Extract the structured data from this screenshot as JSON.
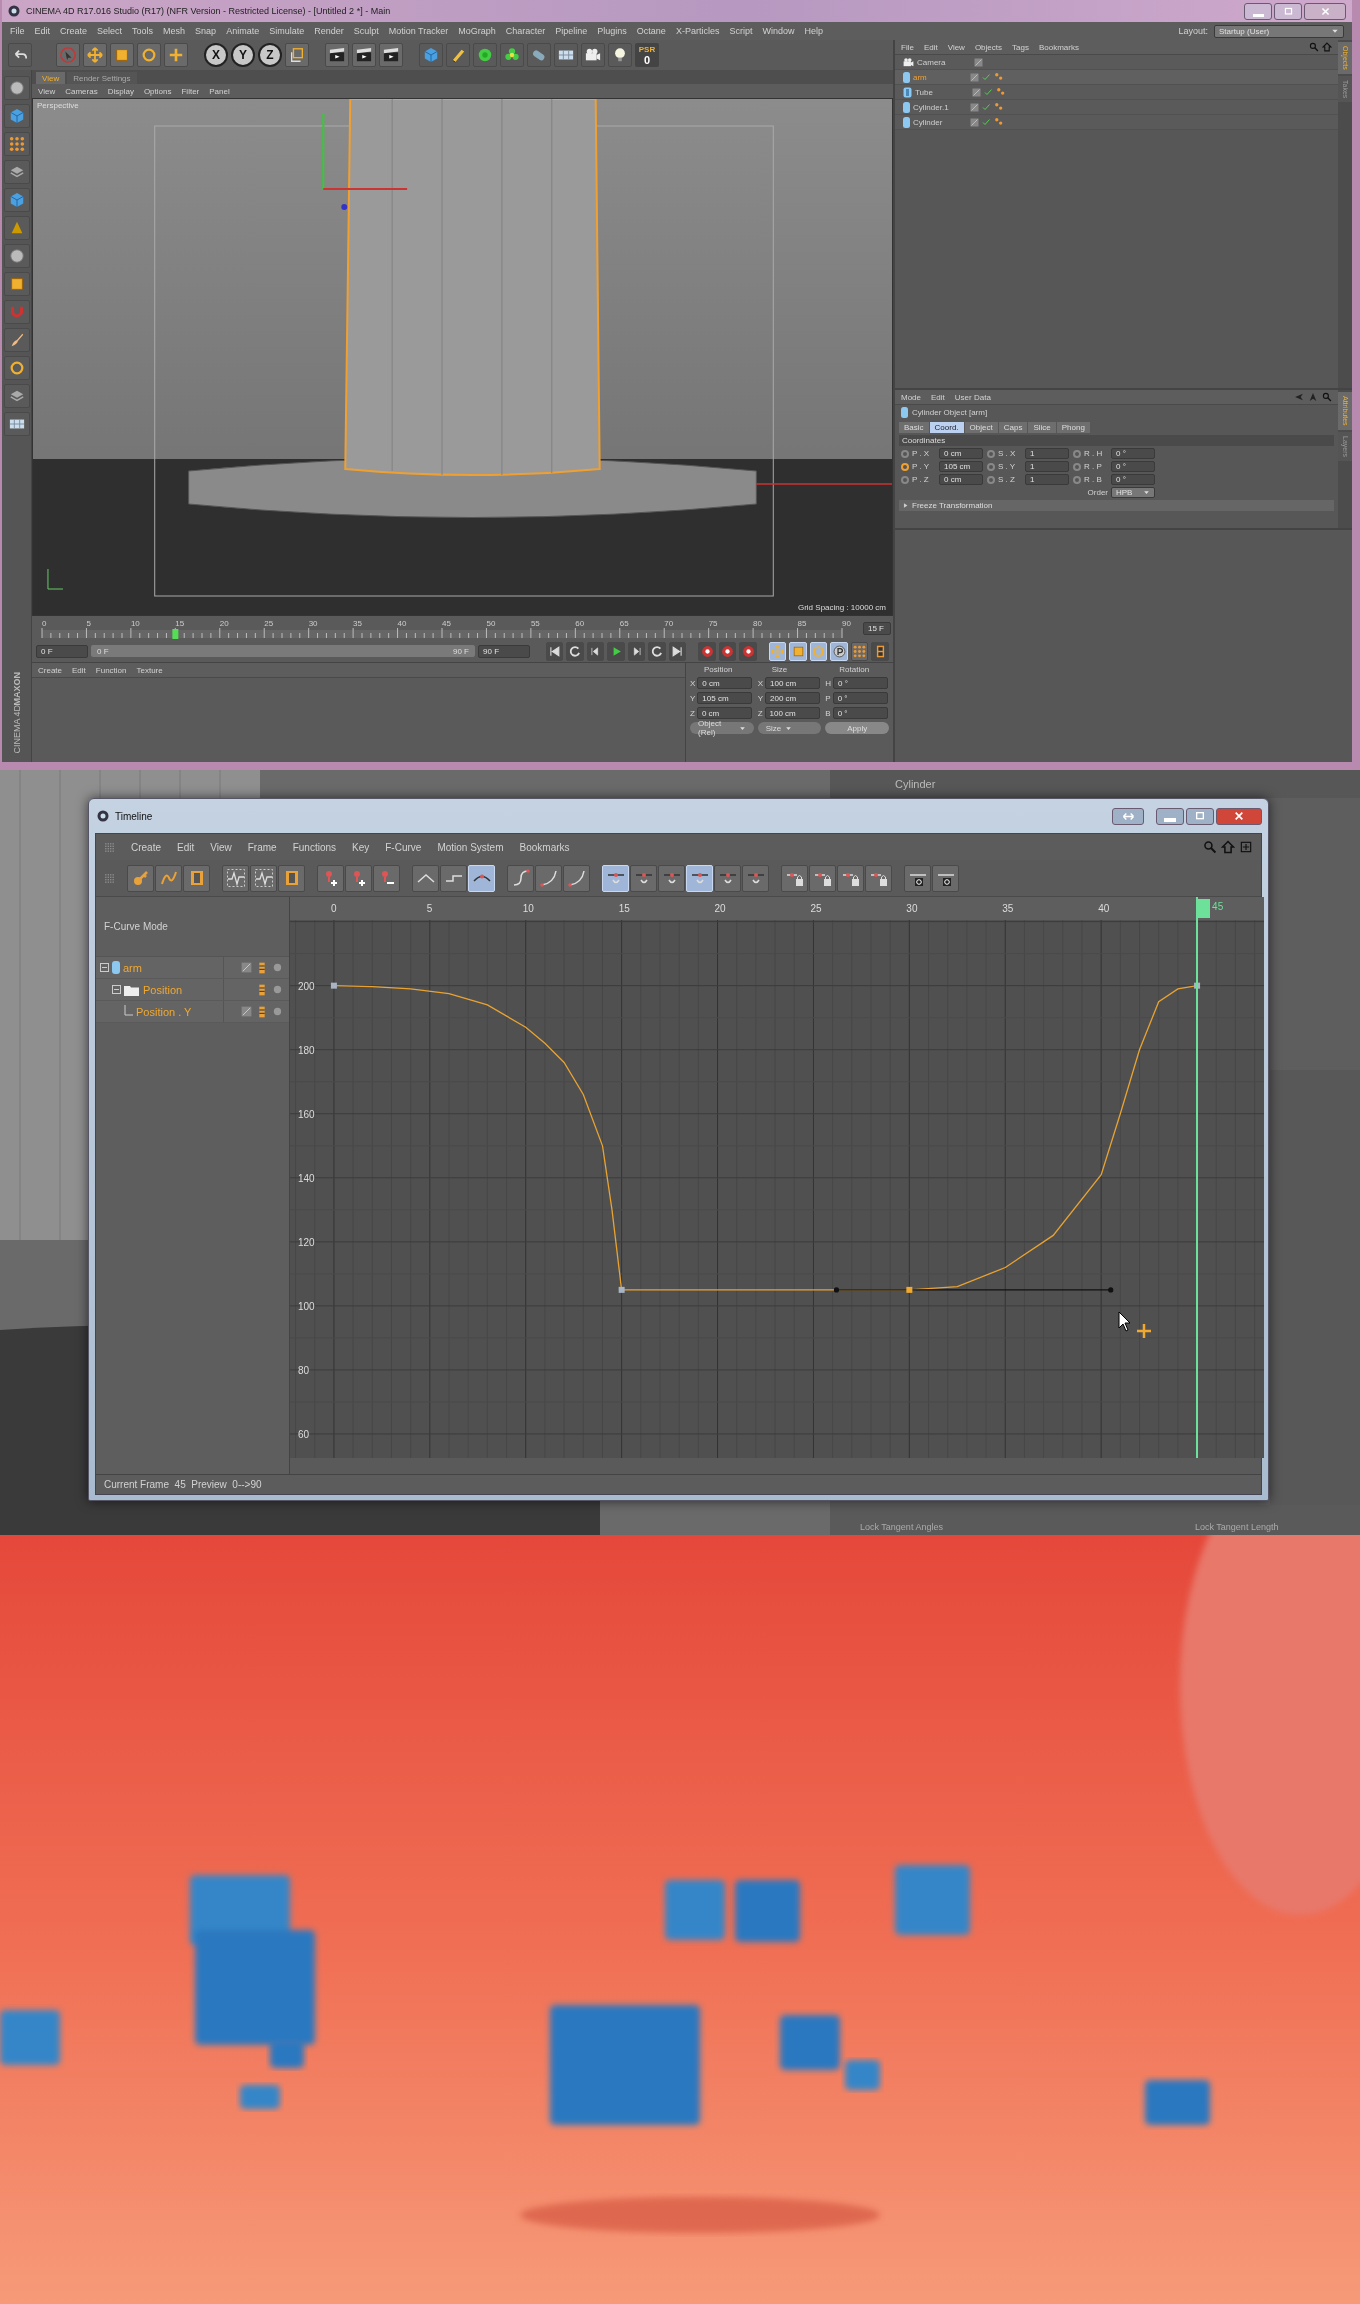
{
  "main_window": {
    "title": "CINEMA 4D R17.016 Studio (R17) (NFR Version - Restricted License) - [Untitled 2 *] - Main",
    "menu": [
      "File",
      "Edit",
      "Create",
      "Select",
      "Tools",
      "Mesh",
      "Snap",
      "Animate",
      "Simulate",
      "Render",
      "Sculpt",
      "Motion Tracker",
      "MoGraph",
      "Character",
      "Pipeline",
      "Plugins",
      "Octane",
      "X-Particles",
      "Script",
      "Window",
      "Help"
    ],
    "layout_label": "Layout:",
    "layout_value": "Startup (User)",
    "toolbar_letters": [
      "X",
      "Y",
      "Z"
    ],
    "psr": {
      "label": "PSR",
      "value": "0"
    },
    "viewport": {
      "tabs": [
        {
          "label": "View",
          "selected": true
        },
        {
          "label": "Render Settings",
          "selected": false
        }
      ],
      "menu": [
        "View",
        "Cameras",
        "Display",
        "Options",
        "Filter",
        "Panel"
      ],
      "camera": "Perspective",
      "grid_spacing": "Grid Spacing : 10000 cm"
    },
    "object_manager": {
      "menu": [
        "File",
        "Edit",
        "View",
        "Objects",
        "Tags",
        "Bookmarks"
      ],
      "objects": [
        {
          "name": "Camera",
          "kind": "camera",
          "selected": false
        },
        {
          "name": "arm",
          "kind": "cylinder",
          "selected": true
        },
        {
          "name": "Tube",
          "kind": "tube",
          "selected": false
        },
        {
          "name": "Cylinder.1",
          "kind": "cylinder",
          "selected": false
        },
        {
          "name": "Cylinder",
          "kind": "cylinder",
          "selected": false
        }
      ],
      "side_tabs": [
        {
          "label": "Objects",
          "selected": true
        },
        {
          "label": "Takes",
          "selected": false
        }
      ]
    },
    "attributes": {
      "menu": [
        "Mode",
        "Edit",
        "User Data"
      ],
      "object_title": "Cylinder Object [arm]",
      "tabs": [
        {
          "label": "Basic",
          "selected": false
        },
        {
          "label": "Coord.",
          "selected": true
        },
        {
          "label": "Object",
          "selected": false
        },
        {
          "label": "Caps",
          "selected": false
        },
        {
          "label": "Slice",
          "selected": false
        },
        {
          "label": "Phong",
          "selected": false
        }
      ],
      "section": "Coordinates",
      "rows": [
        [
          {
            "label": "P . X",
            "value": "0 cm",
            "keyed": false
          },
          {
            "label": "S . X",
            "value": "1",
            "keyed": false
          },
          {
            "label": "R . H",
            "value": "0 °",
            "keyed": false
          }
        ],
        [
          {
            "label": "P . Y",
            "value": "105 cm",
            "keyed": true
          },
          {
            "label": "S . Y",
            "value": "1",
            "keyed": false
          },
          {
            "label": "R . P",
            "value": "0 °",
            "keyed": false
          }
        ],
        [
          {
            "label": "P . Z",
            "value": "0 cm",
            "keyed": false
          },
          {
            "label": "S . Z",
            "value": "1",
            "keyed": false
          },
          {
            "label": "R . B",
            "value": "0 °",
            "keyed": false
          }
        ]
      ],
      "order_label": "Order",
      "order_value": "HPB",
      "freeze": "Freeze Transformation",
      "side_tabs": [
        {
          "label": "Attributes",
          "selected": true
        },
        {
          "label": "Layers",
          "selected": false
        }
      ]
    },
    "timeline": {
      "ticks": [
        "0",
        "5",
        "10",
        "15",
        "20",
        "25",
        "30",
        "35",
        "40",
        "45",
        "50",
        "55",
        "60",
        "65",
        "70",
        "75",
        "80",
        "85",
        "90"
      ],
      "playhead": {
        "level": 0.1667
      },
      "start_field": "0 F",
      "slider": {
        "start": "0 F",
        "end": "90 F",
        "level": 1
      },
      "end_field": "90 F",
      "frame_field": "15 F"
    },
    "material_menu": [
      "Create",
      "Edit",
      "Function",
      "Texture"
    ],
    "logo": {
      "brand": "MAXON",
      "product": "CINEMA 4D"
    },
    "coordinates": {
      "headers": [
        "Position",
        "Size",
        "Rotation"
      ],
      "rows": [
        [
          {
            "axis": "X",
            "value": "0 cm"
          },
          {
            "axis": "X",
            "value": "100 cm"
          },
          {
            "axis": "H",
            "value": "0 °"
          }
        ],
        [
          {
            "axis": "Y",
            "value": "105 cm"
          },
          {
            "axis": "Y",
            "value": "200 cm"
          },
          {
            "axis": "P",
            "value": "0 °"
          }
        ],
        [
          {
            "axis": "Z",
            "value": "0 cm"
          },
          {
            "axis": "Z",
            "value": "100 cm"
          },
          {
            "axis": "B",
            "value": "0 °"
          }
        ]
      ],
      "mode": "Object (Rel)",
      "size_mode": "Size",
      "apply": "Apply"
    }
  },
  "background": {
    "object_label": "Cylinder",
    "fields": [
      "Lock Tangent Angles",
      "Lock Tangent Length"
    ]
  },
  "timeline_window": {
    "title": "Timeline",
    "menu": [
      "Create",
      "Edit",
      "View",
      "Frame",
      "Functions",
      "Key",
      "F-Curve",
      "Motion System",
      "Bookmarks"
    ],
    "toolbar": [
      [
        {
          "selected": false
        },
        {
          "selected": false
        },
        {
          "selected": false
        }
      ],
      [
        {
          "selected": false
        },
        {
          "selected": false
        },
        {
          "selected": false
        }
      ],
      [
        {
          "selected": false
        },
        {
          "selected": false
        },
        {
          "selected": false
        }
      ],
      [
        {
          "selected": false
        },
        {
          "selected": false
        },
        {
          "selected": true
        }
      ],
      [
        {
          "selected": false
        },
        {
          "selected": false
        },
        {
          "selected": false
        }
      ],
      [
        {
          "selected": true
        },
        {
          "selected": false
        },
        {
          "selected": false
        },
        {
          "selected": true
        },
        {
          "selected": false
        },
        {
          "selected": false
        }
      ],
      [
        {
          "selected": false
        },
        {
          "selected": false
        },
        {
          "selected": false
        },
        {
          "selected": false
        }
      ],
      [
        {
          "selected": false
        },
        {
          "selected": false
        }
      ]
    ],
    "mode_label": "F-Curve Mode",
    "tracks": [
      {
        "name": "arm",
        "kind": "object",
        "expanded": true,
        "children": [
          {
            "name": "Position",
            "kind": "folder",
            "expanded": true,
            "children": [
              {
                "name": "Position . Y",
                "kind": "track"
              }
            ]
          }
        ]
      }
    ],
    "chart_data": {
      "type": "line",
      "x": [
        0,
        2,
        4,
        6,
        8,
        10,
        11,
        12,
        13,
        14,
        14.5,
        15,
        20,
        25,
        30,
        32.5,
        35,
        37.5,
        40,
        41,
        42,
        43,
        44,
        45
      ],
      "series": [
        {
          "color": "#e8a332",
          "values": [
            200,
            199.7,
            199,
            197.5,
            194,
            187,
            182,
            176,
            166,
            150,
            130,
            105,
            105,
            105,
            105,
            106,
            112,
            122,
            141,
            160,
            180,
            195,
            199,
            200
          ]
        }
      ],
      "xlim": [
        -2.29,
        48.49
      ],
      "ylim": [
        52.5,
        220.5
      ],
      "xticks": [
        0,
        5,
        10,
        15,
        20,
        25,
        30,
        35,
        40
      ],
      "yticks": [
        60,
        80,
        100,
        120,
        140,
        160,
        180,
        200
      ],
      "grid": true
    },
    "keyframes": [
      {
        "selected": false
      },
      {
        "selected": false
      },
      {
        "selected": true
      },
      {
        "selected": false
      }
    ],
    "current_frame": {
      "label": "45",
      "level": 0.9313
    },
    "status": "Current Frame  45  Preview  0-->90"
  }
}
